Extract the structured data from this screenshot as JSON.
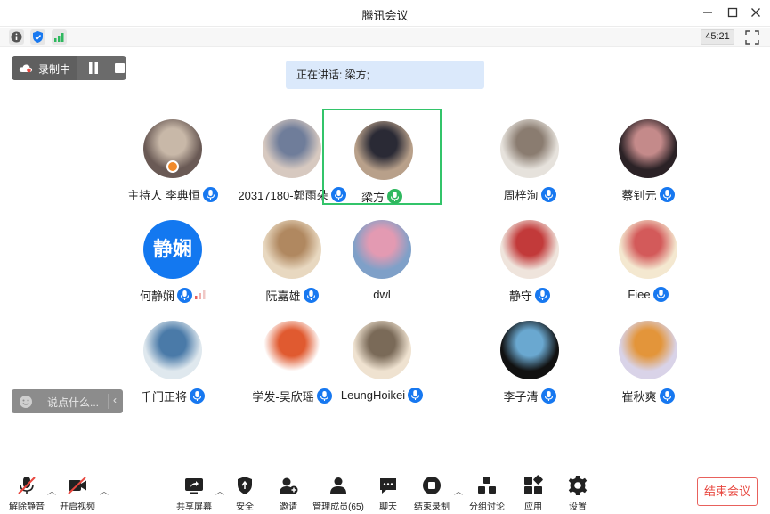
{
  "window": {
    "title": "腾讯会议",
    "timer": "45:21"
  },
  "recording": {
    "label": "录制中"
  },
  "speaking": {
    "text": "正在讲话: 梁方;"
  },
  "participants": [
    {
      "name": "主持人 李典恒",
      "avatar": "photo",
      "host": true
    },
    {
      "name": "20317180-郭雨朵",
      "avatar": "photo"
    },
    {
      "name": "梁方",
      "avatar": "photo",
      "talking": true
    },
    {
      "name": "周梓洵",
      "avatar": "photo"
    },
    {
      "name": "蔡钊元",
      "avatar": "photo"
    },
    {
      "name": "何静娴",
      "avatar": "text",
      "avatar_text": "静娴",
      "signal": true
    },
    {
      "name": "阮嘉雄",
      "avatar": "photo"
    },
    {
      "name": "dwl",
      "avatar": "photo",
      "no_mic": true
    },
    {
      "name": "静守",
      "avatar": "photo"
    },
    {
      "name": "Fiee",
      "avatar": "photo"
    },
    {
      "name": "千门正将",
      "avatar": "photo"
    },
    {
      "name": "学发-吴欣瑶",
      "avatar": "photo"
    },
    {
      "name": "LeungHoikei",
      "avatar": "photo"
    },
    {
      "name": "李子清",
      "avatar": "photo"
    },
    {
      "name": "崔秋爽",
      "avatar": "photo"
    }
  ],
  "chat": {
    "placeholder": "说点什么..."
  },
  "toolbar": {
    "unmute": "解除静音",
    "start_video": "开启视频",
    "share_screen": "共享屏幕",
    "security": "安全",
    "invite": "邀请",
    "manage_members": "管理成员(65)",
    "chat": "聊天",
    "end_recording": "结束录制",
    "breakout": "分组讨论",
    "apps": "应用",
    "settings": "设置",
    "end_meeting": "结束会议"
  },
  "colors": {
    "accent": "#1778f0",
    "talking": "#2fb85f",
    "danger": "#e8473f",
    "speaking_banner": "#dbe9fb"
  }
}
